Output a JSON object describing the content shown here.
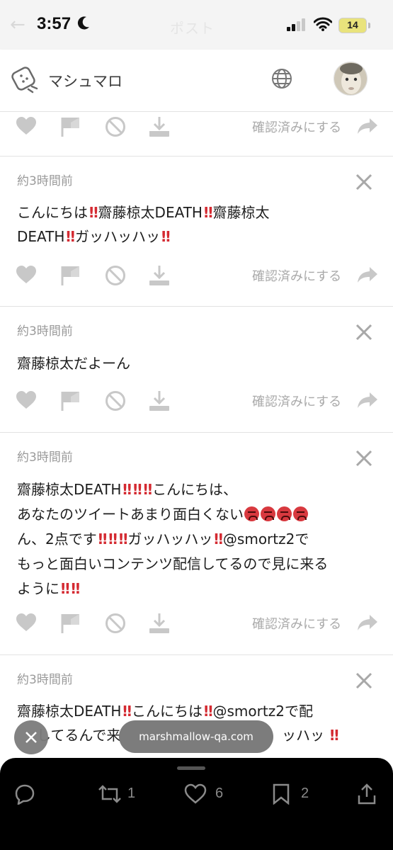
{
  "status_bar": {
    "time": "3:57",
    "ghost_title": "ポスト",
    "battery": "14"
  },
  "header": {
    "app_name": "マシュマロ"
  },
  "labels": {
    "confirm": "確認済みにする"
  },
  "messages": [
    {
      "time": "約3時間前",
      "lines": [
        [
          "こんにちは",
          "‼",
          "齋藤椋太DEATH",
          "‼",
          "齋藤椋太"
        ],
        [
          "DEATH",
          "‼",
          "ガッハッハッ",
          "‼"
        ]
      ]
    },
    {
      "time": "約3時間前",
      "lines": [
        [
          "齋藤椋太だよーん"
        ]
      ]
    },
    {
      "time": "約3時間前",
      "lines": [
        [
          "齋藤椋太DEATH",
          "‼",
          "‼",
          "‼",
          "こんにちは、"
        ],
        [
          "あなたのツイートあまり面白くない",
          "😡",
          "😡",
          "😡",
          "😡"
        ],
        [
          "ん、2点です",
          "‼",
          "‼",
          "‼",
          "ガッハッハッ",
          "‼",
          "@smortz2で"
        ],
        [
          "もっと面白いコンテンツ配信してるので見に来る"
        ],
        [
          "ように",
          "‼",
          "‼"
        ]
      ]
    },
    {
      "time": "約3時間前",
      "lines": [
        [
          "齋藤椋太DEATH",
          "‼",
          "こんにちは",
          "‼",
          "@smortz2で配"
        ],
        [
          "してるんで来",
          "ッハッ",
          "‼"
        ]
      ]
    }
  ],
  "overlay": {
    "url": "marshmallow-qa.com"
  },
  "bottom_bar": {
    "retweets": "1",
    "likes": "6",
    "bookmarks": "2"
  }
}
